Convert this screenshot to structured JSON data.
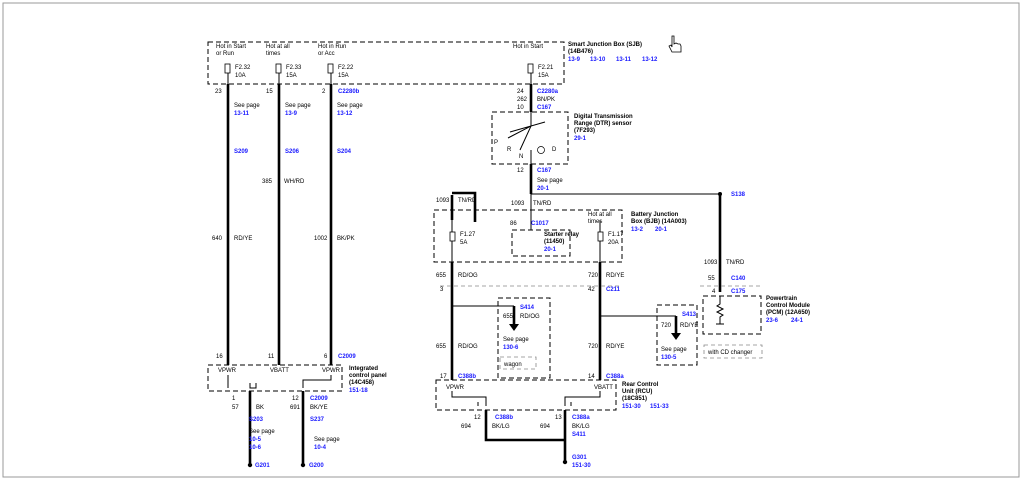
{
  "sjb": {
    "title": "Smart Junction Box (SJB)",
    "part": "(14B476)",
    "pages": [
      "13-9",
      "13-10",
      "13-11",
      "13-12"
    ],
    "fuses": [
      {
        "state": [
          "Hot in Start",
          "or Run"
        ],
        "id": "F2.32",
        "amp": "10A"
      },
      {
        "state": [
          "Hot at all",
          "times"
        ],
        "id": "F2.33",
        "amp": "15A"
      },
      {
        "state": [
          "Hot in Run",
          "or Acc"
        ],
        "id": "F2.22",
        "amp": "15A"
      },
      {
        "state": [
          "Hot in Start"
        ],
        "id": "F2.21",
        "amp": "15A"
      }
    ]
  },
  "left_wires": [
    {
      "pin": "23",
      "see": "See page",
      "page": "13-11",
      "splice": "S209",
      "circuit": "640",
      "color": "RD/YE"
    },
    {
      "pin": "15",
      "see": "See page",
      "page": "13-9",
      "splice": "S206",
      "circuit": "385",
      "color": "WH/RD"
    },
    {
      "pin": "2",
      "see": "See page",
      "page": "13-12",
      "splice": "S204",
      "circuit": "1002",
      "color": "BK/PK"
    }
  ],
  "c2280b": "C2280b",
  "c2280a": "C2280a",
  "dtr": {
    "pin_top": "24",
    "circuit_top": "262",
    "color_top": "BN/PK",
    "pin_c167": "10",
    "c167": "C167",
    "title": [
      "Digital Transmission",
      "Range (DTR) sensor",
      "(7F293)"
    ],
    "page": "29-1",
    "positions": [
      "P",
      "R",
      "N",
      "D"
    ],
    "pin_bottom": "12",
    "c167b": "C167",
    "see": "See page",
    "see_page": "20-1"
  },
  "tn_rd": {
    "circuit_a": "1093",
    "color_a": "TN/RD",
    "circuit_b": "1093",
    "color_b": "TN/RD",
    "splice": "S138"
  },
  "bjb": {
    "title": [
      "Battery Junction",
      "Box (BJB) (14A003)"
    ],
    "pages": [
      "13-2",
      "20-1"
    ],
    "hot": [
      "Hot at all",
      "times"
    ],
    "fuse_a": {
      "id": "F1.27",
      "amp": "5A"
    },
    "fuse_b": {
      "id": "F1.17",
      "amp": "20A"
    },
    "relay_pin": "86",
    "c1017": "C1017",
    "relay": [
      "Starter relay",
      "(11450)"
    ],
    "relay_page": "20-1"
  },
  "mid": {
    "w1_circuit": "655",
    "w1_color": "RD/OG",
    "w2_circuit": "720",
    "w2_color": "RD/YE",
    "pin3": "3",
    "pin42": "42",
    "c211": "C211",
    "s414": "S414",
    "s414_circuit": "655",
    "s414_color": "RD/OG",
    "s414_see": "See page",
    "s414_page": "130-6",
    "wagon": "wagon",
    "s413": "S413",
    "s413_circuit": "720",
    "s413_color": "RD/YE",
    "s413_see": "See page",
    "s413_page": "130-5",
    "w3_circuit": "655",
    "w3_color": "RD/OG",
    "w4_circuit": "720",
    "w4_color": "RD/YE",
    "pin17": "17",
    "c388b": "C388b",
    "pin14": "14",
    "c388a": "C388a"
  },
  "pcm": {
    "tn_circuit": "1093",
    "tn_color": "TN/RD",
    "pin55": "55",
    "c140": "C140",
    "pin4": "4",
    "c175": "C175",
    "title": [
      "Powertrain",
      "Control Module",
      "(PCM) (12A650)"
    ],
    "pages": [
      "23-6",
      "24-1"
    ],
    "cd": "with CD changer"
  },
  "icp": {
    "pins": [
      "16",
      "11",
      "6"
    ],
    "c2009": "C2009",
    "labels": [
      "VPWR",
      "VBATT",
      "VPWR"
    ],
    "title": [
      "Integrated",
      "control panel",
      "(14C458)"
    ],
    "pages": [
      "151-18"
    ],
    "pin1": "1",
    "pin12": "12",
    "c2009b": "C2009",
    "g1_circuit": "57",
    "g1_color": "BK",
    "g2_circuit": "691",
    "g2_color": "BK/YE",
    "s203": "S203",
    "s237": "S237",
    "see": "See page",
    "g1_pages": [
      "10-5",
      "10-6"
    ],
    "g2_page": "10-4",
    "g201": "G201",
    "g200": "G200"
  },
  "rcu": {
    "labels": [
      "VPWR",
      "VBATT"
    ],
    "title": [
      "Rear Control",
      "Unit (RCU)",
      "(18C851)"
    ],
    "pages": [
      "151-30",
      "151-33"
    ],
    "pin12": "12",
    "pin13": "13",
    "c388b": "C388b",
    "c388a": "C388a",
    "c1_circuit": "694",
    "c1_color": "BK/LG",
    "c2_circuit": "694",
    "c2_color": "BK/LG",
    "s411": "S411",
    "g301": "G301",
    "g301_page": "151-30"
  }
}
